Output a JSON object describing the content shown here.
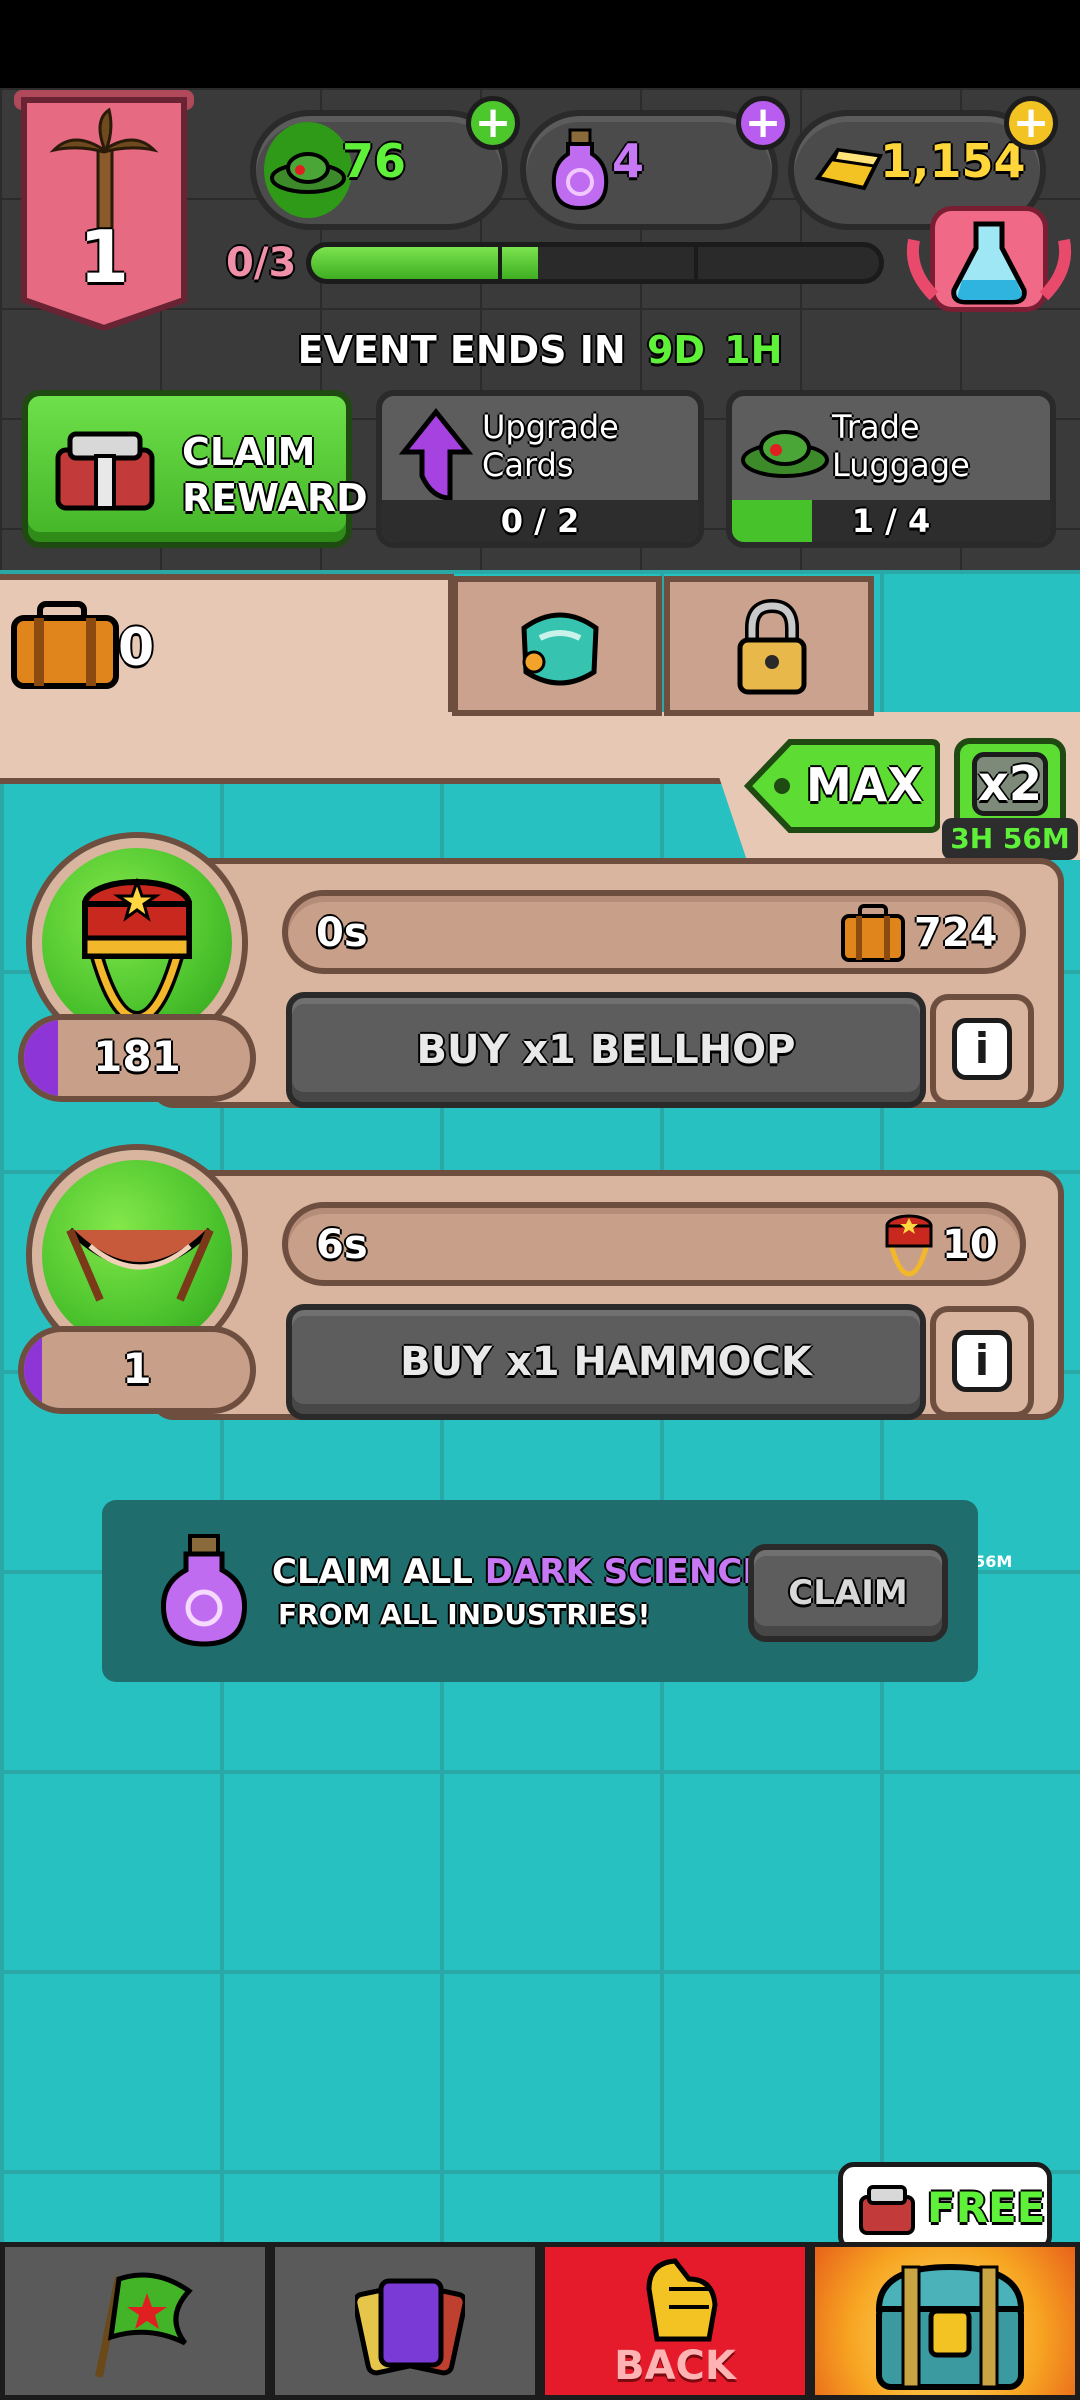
{
  "resources": {
    "cash": "76",
    "dark_science": "4",
    "gold": "1,154"
  },
  "rank": {
    "level": "1",
    "progress_text": "0/3",
    "progress_fraction": 0.4
  },
  "event": {
    "ends_label": "EVENT ENDS IN",
    "days": "9D",
    "hours": "1H"
  },
  "missions": [
    {
      "label_line1": "CLAIM",
      "label_line2": "REWARD"
    },
    {
      "label_line1": "Upgrade",
      "label_line2": "Cards",
      "progress": "0 / 2",
      "fraction": 0.0
    },
    {
      "label_line1": "Trade",
      "label_line2": "Luggage",
      "progress": "1 / 4",
      "fraction": 0.25
    }
  ],
  "luggage_count": "0",
  "max_button": "MAX",
  "boost": {
    "label": "x2",
    "timer": "3H 56M"
  },
  "industries": [
    {
      "time": "0s",
      "reward": "724",
      "owned": "181",
      "buy_label": "BUY x1 BELLHOP",
      "info": "i",
      "fill_fraction": 0.15
    },
    {
      "time": "6s",
      "reward": "10",
      "owned": "1",
      "buy_label": "BUY x1 HAMMOCK",
      "info": "i",
      "fill_fraction": 0.08
    }
  ],
  "claim_banner": {
    "prefix": "CLAIM ALL",
    "highlight": "DARK SCIENCE",
    "line2": "FROM ALL INDUSTRIES!",
    "button": "CLAIM"
  },
  "free_badge": "FREE",
  "nav": {
    "back_label": "BACK"
  },
  "colors": {
    "accent_green": "#4cc72c",
    "dark_science_purple": "#b95cf0",
    "gold": "#f3c323",
    "teal_bg": "#27c1c1",
    "back_red": "#e51a2a"
  }
}
